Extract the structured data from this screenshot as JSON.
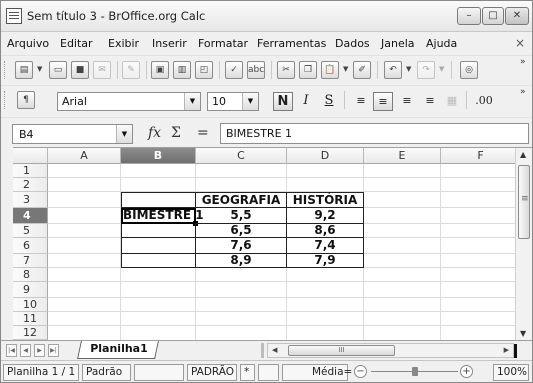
{
  "window": {
    "title": "Sem título 3 - BrOffice.org Calc",
    "controls": {
      "minimize": "–",
      "maximize": "□",
      "close": "✕"
    }
  },
  "menubar": {
    "items": [
      "Arquivo",
      "Editar",
      "Exibir",
      "Inserir",
      "Formatar",
      "Ferramentas",
      "Dados",
      "Janela",
      "Ajuda"
    ],
    "close_doc": "×"
  },
  "toolbar_standard": {
    "icons": [
      "new-icon",
      "open-icon",
      "save-icon",
      "email-icon",
      "edit-file-icon",
      "export-pdf-icon",
      "print-icon",
      "page-preview-icon",
      "spellcheck-icon",
      "autospellcheck-icon",
      "cut-icon",
      "copy-icon",
      "paste-icon",
      "clone-format-icon",
      "undo-icon",
      "redo-icon",
      "navigator-icon"
    ],
    "more": "»"
  },
  "toolbar_formatting": {
    "font_name": "Arial",
    "font_size": "10",
    "bold": "N",
    "italic": "I",
    "underline": "S",
    "more": "»"
  },
  "formula_bar": {
    "name_box": "B4",
    "function_wizard": "fx",
    "sum": "Σ",
    "equals": "=",
    "content": "BIMESTRE 1"
  },
  "grid": {
    "columns": [
      "A",
      "B",
      "C",
      "D",
      "E",
      "F"
    ],
    "selected_column": "B",
    "rows": [
      "1",
      "2",
      "3",
      "4",
      "5",
      "6",
      "7",
      "8",
      "9",
      "10",
      "11",
      "12"
    ],
    "selected_row": "4",
    "cells": {
      "C3": "GEOGRAFIA",
      "D3": "HISTÓRIA",
      "B4": "BIMESTRE 1",
      "C4": "5,5",
      "D4": "9,2",
      "C5": "6,5",
      "D5": "8,6",
      "C6": "7,6",
      "D6": "7,4",
      "C7": "8,9",
      "D7": "7,9"
    }
  },
  "sheet_tabs": {
    "tabs": [
      "Planilha1"
    ],
    "hscroll_thumb": "III"
  },
  "statusbar": {
    "sheet": "Planilha 1 / 1",
    "page_style": "Padrão",
    "insert_mode": "",
    "selection_mode": "PADRÃO",
    "modified": "*",
    "signature": "",
    "sum_label": "Média=",
    "zoom": "100%"
  }
}
